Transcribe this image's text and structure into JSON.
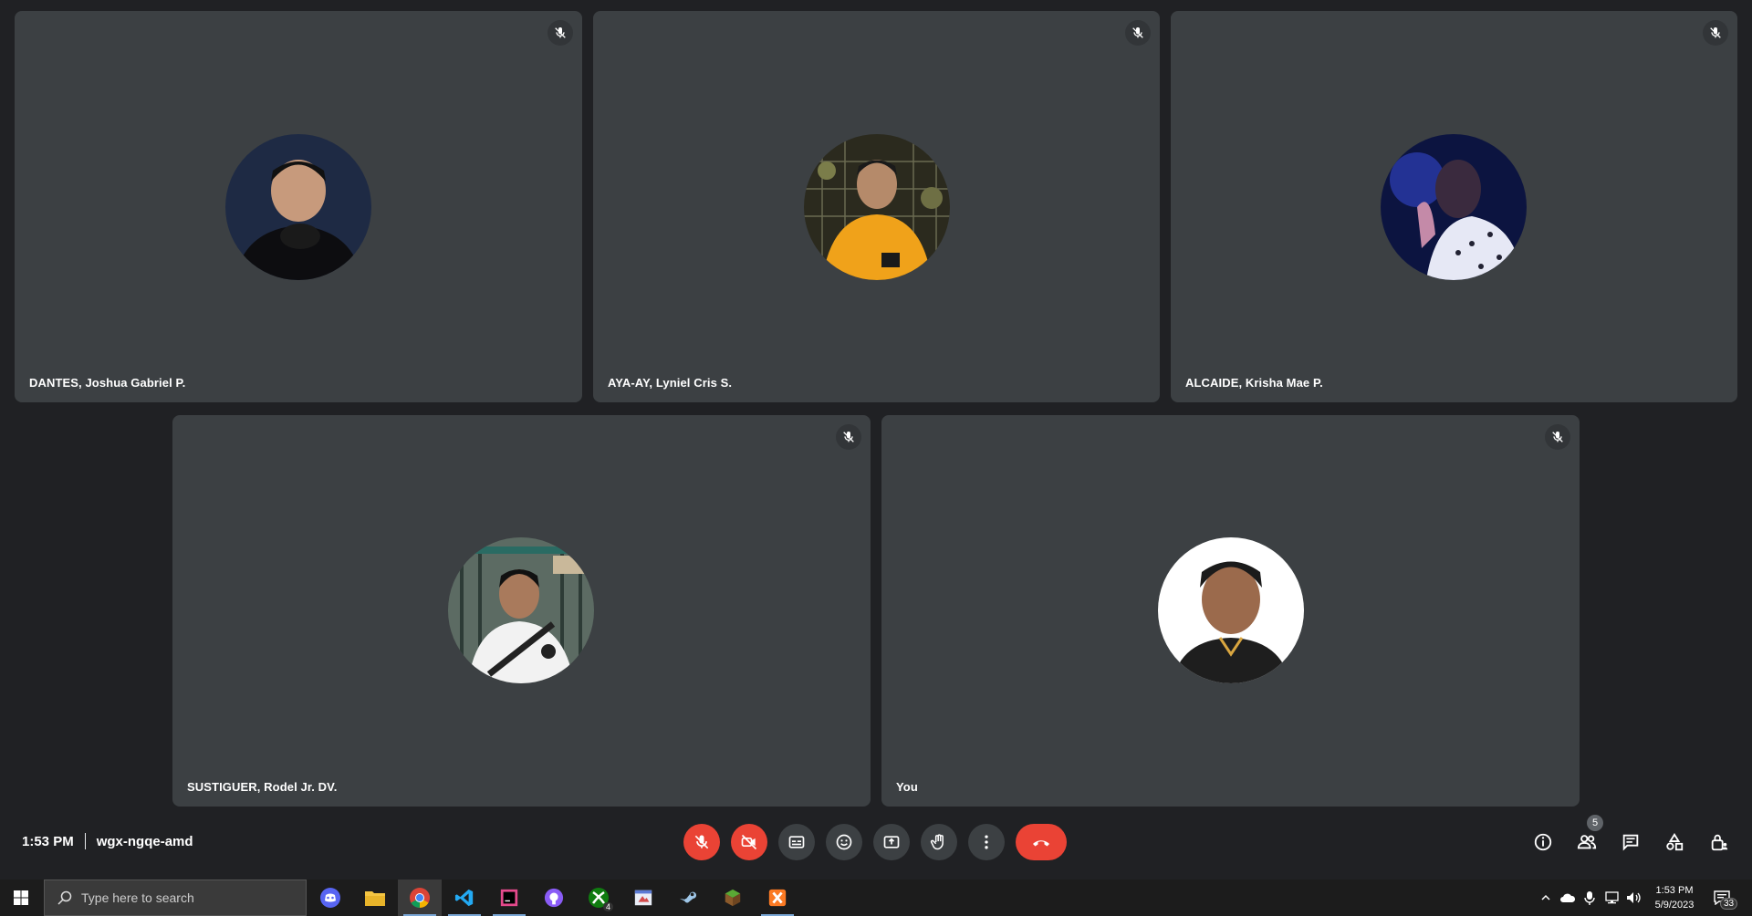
{
  "participants": [
    {
      "name": "DANTES, Joshua Gabriel P.",
      "muted": true,
      "avatar_icon": "person-photo-dark-suit"
    },
    {
      "name": "AYA-AY, Lyniel Cris S.",
      "muted": true,
      "avatar_icon": "person-photo-orange-shirt"
    },
    {
      "name": "ALCAIDE, Krisha Mae P.",
      "muted": true,
      "avatar_icon": "person-photo-blue-light"
    },
    {
      "name": "SUSTIGUER, Rodel Jr. DV.",
      "muted": true,
      "avatar_icon": "person-photo-white-shirt"
    },
    {
      "name": "You",
      "muted": true,
      "avatar_icon": "person-photo-white-bg"
    }
  ],
  "meeting": {
    "time": "1:53 PM",
    "code": "wgx-ngqe-amd"
  },
  "controls": {
    "mic": "microphone-off-icon",
    "camera": "camera-off-icon",
    "captions": "captions-icon",
    "reactions": "emoji-icon",
    "present": "present-screen-icon",
    "raise_hand": "raise-hand-icon",
    "more": "more-options-icon",
    "leave": "end-call-icon"
  },
  "right_controls": {
    "people_count": "5"
  },
  "taskbar": {
    "search_placeholder": "Type here to search",
    "xbox_badge": "4",
    "clock_time": "1:53 PM",
    "clock_date": "5/9/2023",
    "notification_count": "33"
  },
  "colors": {
    "background": "#202124",
    "tile": "#3c4043",
    "danger": "#ea4335",
    "taskbar": "#1c1c1c"
  }
}
